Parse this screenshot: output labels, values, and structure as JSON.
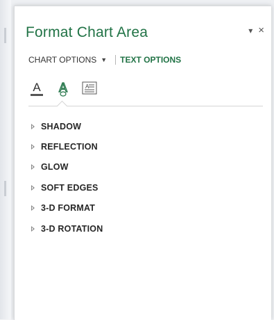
{
  "pane": {
    "title": "Format Chart Area",
    "menu_caret": "▾",
    "close_glyph": "×"
  },
  "tabs": {
    "chart_options": "CHART OPTIONS",
    "chart_options_caret": "▼",
    "text_options": "TEXT OPTIONS"
  },
  "icons": [
    {
      "name": "text-fill-outline-icon",
      "selected": false
    },
    {
      "name": "text-effects-icon",
      "selected": true
    },
    {
      "name": "textbox-icon",
      "selected": false
    }
  ],
  "sections": [
    {
      "label": "SHADOW"
    },
    {
      "label": "REFLECTION"
    },
    {
      "label": "GLOW"
    },
    {
      "label": "SOFT EDGES"
    },
    {
      "label": "3-D FORMAT"
    },
    {
      "label": "3-D ROTATION"
    }
  ],
  "colors": {
    "accent": "#217346",
    "text": "#262626",
    "arrow": "#8a8a8a"
  }
}
